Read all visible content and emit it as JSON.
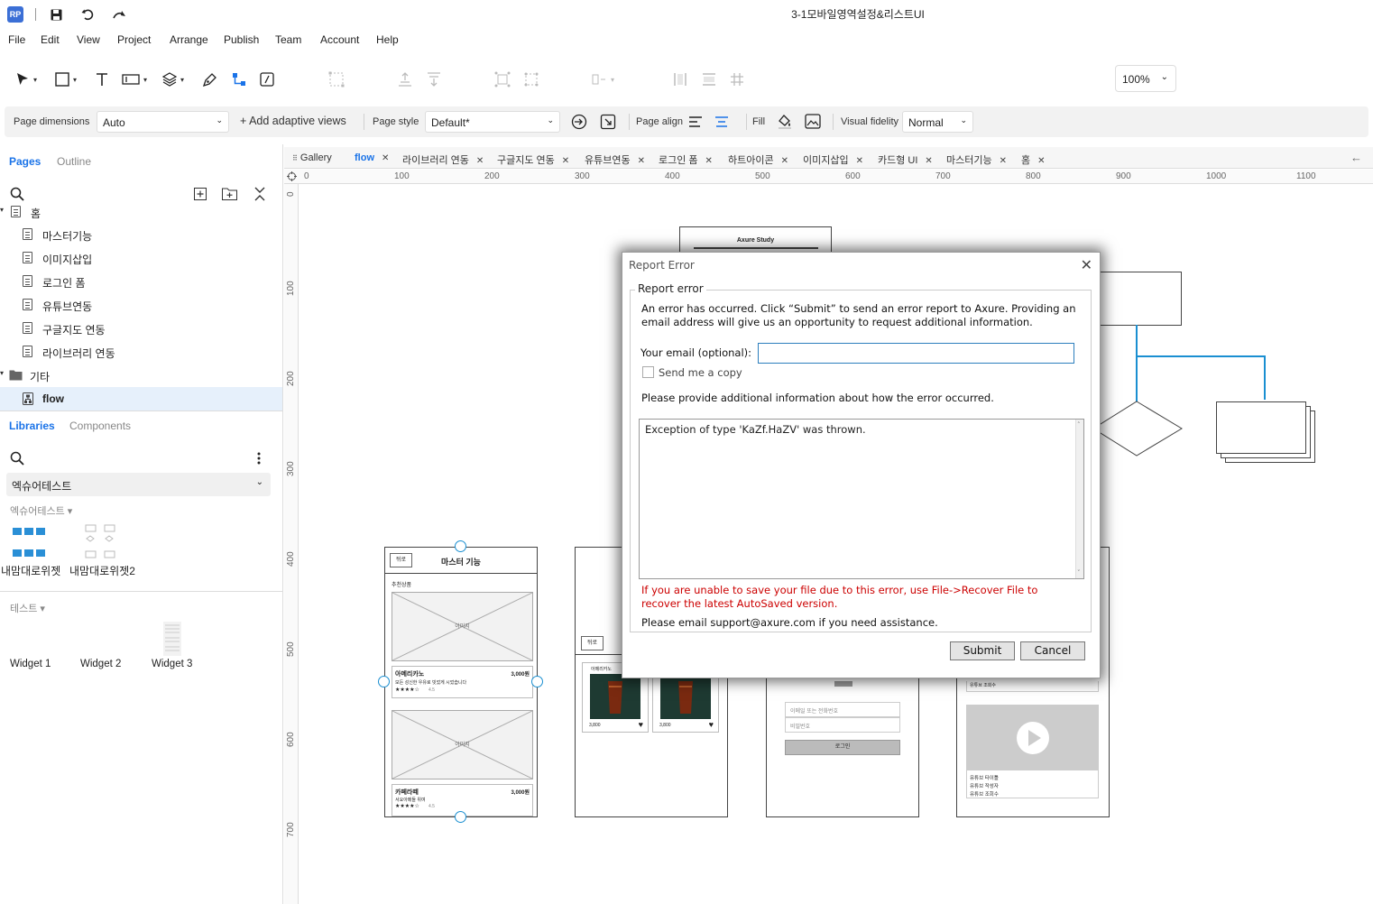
{
  "app": {
    "logo": "RP",
    "title": "3-1모바일영역설정&리스트UI"
  },
  "titlebar_icons": [
    "save-icon",
    "undo-icon",
    "redo-icon"
  ],
  "menu": [
    "File",
    "Edit",
    "View",
    "Project",
    "Arrange",
    "Publish",
    "Team",
    "Account",
    "Help"
  ],
  "zoom": "100%",
  "stylebar": {
    "page_dimensions_label": "Page dimensions",
    "page_dimensions_value": "Auto",
    "adaptive_views": "+ Add adaptive views",
    "page_style_label": "Page style",
    "page_style_value": "Default*",
    "page_align_label": "Page align",
    "fill_label": "Fill",
    "visual_fidelity_label": "Visual fidelity",
    "visual_fidelity_value": "Normal"
  },
  "left": {
    "tabs": {
      "pages": "Pages",
      "outline": "Outline"
    },
    "pages": [
      {
        "label": "홈"
      },
      {
        "label": "마스터기능"
      },
      {
        "label": "이미지삽입"
      },
      {
        "label": "로그인 폼"
      },
      {
        "label": "유튜브연동"
      },
      {
        "label": "구글지도 연동"
      },
      {
        "label": "라이브러리 연동"
      },
      {
        "label": "기타"
      },
      {
        "label": "flow"
      }
    ],
    "lib_tabs": {
      "libraries": "Libraries",
      "components": "Components"
    },
    "library_select": "엑슈어테스트",
    "group1_label": "엑슈어테스트 ▾",
    "group1_items": [
      "내맘대로위젯",
      "내맘대로위젯2"
    ],
    "group2_label": "테스트 ▾",
    "group2_items": [
      "Widget 1",
      "Widget 2",
      "Widget 3"
    ]
  },
  "page_tabs": [
    {
      "label": "Gallery",
      "closable": false
    },
    {
      "label": "flow",
      "closable": true,
      "active": true
    },
    {
      "label": "라이브러리 연동",
      "closable": true
    },
    {
      "label": "구글지도 연동",
      "closable": true
    },
    {
      "label": "유튜브연동",
      "closable": true
    },
    {
      "label": "로그인 폼",
      "closable": true
    },
    {
      "label": "하트아이콘",
      "closable": true
    },
    {
      "label": "이미지삽입",
      "closable": true
    },
    {
      "label": "카드형 UI",
      "closable": true
    },
    {
      "label": "마스터기능",
      "closable": true
    },
    {
      "label": "홈",
      "closable": true
    }
  ],
  "rulers": {
    "top": [
      "0",
      "100",
      "200",
      "300",
      "400",
      "500",
      "600",
      "700",
      "800",
      "900",
      "1000",
      "1100"
    ],
    "left": [
      "0",
      "100",
      "200",
      "300",
      "400",
      "500",
      "600",
      "700"
    ]
  },
  "canvas": {
    "axure_study": "Axure Study",
    "m1_button": "뒤로",
    "m1_title": "마스터 기능",
    "m1_section": "추천상품",
    "img_label": "이미지",
    "p1_name": "아메리카노",
    "p1_price": "3,000원",
    "p1_desc": "모든 성신한 우유로 빗었게 시었습니다",
    "p1_rating": "4.5",
    "p2_name": "카페라떼",
    "p2_price": "3,000원",
    "p2_desc": "서요아메들 위여",
    "p2_rating": "4.5",
    "stars": "★★★★☆",
    "m2_button": "뒤로",
    "m2_card_label": "아메리카노",
    "m2_price": "3,800",
    "login_id": "이메일 또는 전화번호",
    "login_pw": "비밀번호",
    "login_btn": "로그인",
    "yt_views": "유튜브 조회수",
    "yt_title": "유튜브 타이틀",
    "yt_author": "유튜브 작성자",
    "yt_views2": "유튜브 조회수"
  },
  "dialog": {
    "title": "Report Error",
    "group_label": "Report error",
    "intro": "An error has occurred. Click “Submit” to send an error report to Axure. Providing an email address will give us an opportunity to request additional information.",
    "email_label": "Your email (optional):",
    "email_value": "",
    "send_copy": "Send me a copy",
    "provide_info": "Please provide additional information about how the error occurred.",
    "details": "Exception of type 'KaZf.HaZV' was thrown.",
    "warning": "If you are unable to save your file due to this error, use File->Recover File to recover the latest AutoSaved version.",
    "support": "Please email support@axure.com if you need assistance.",
    "submit": "Submit",
    "cancel": "Cancel"
  },
  "colors": {
    "accent": "#1a73e8",
    "selection_bg": "#e6f0fb",
    "connector": "#1a8fd1",
    "warning": "#cc0000"
  }
}
